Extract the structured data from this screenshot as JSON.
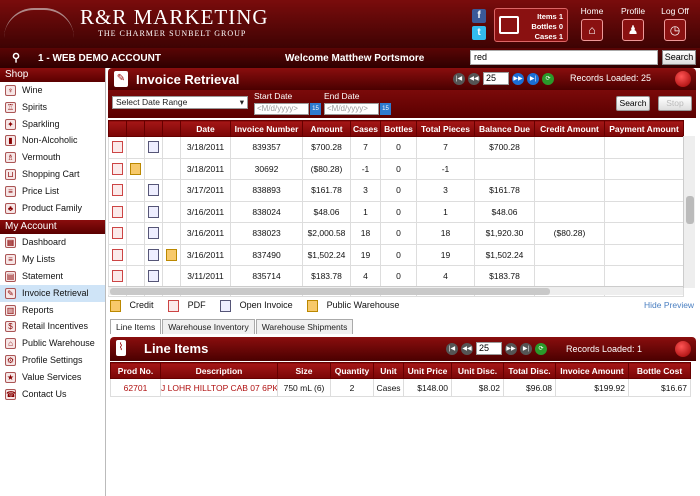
{
  "header": {
    "logo_main": "R&R MARKETING",
    "logo_sub": "THE CHARMER SUNBELT GROUP",
    "cart": {
      "items_label": "Items 1",
      "bottles_label": "Bottles 0",
      "cases_label": "Cases 1"
    },
    "nav": [
      {
        "label": "Home"
      },
      {
        "label": "Profile"
      },
      {
        "label": "Log Off"
      }
    ]
  },
  "subbar": {
    "account": "1 - WEB DEMO ACCOUNT",
    "welcome": "Welcome Matthew Portsmore",
    "search_value": "red",
    "search_button": "Search"
  },
  "sidebar": {
    "shop_title": "Shop",
    "shop_items": [
      "Wine",
      "Spirits",
      "Sparkling",
      "Non-Alcoholic",
      "Vermouth",
      "Shopping Cart",
      "Price List",
      "Product Family"
    ],
    "account_title": "My Account",
    "account_items": [
      "Dashboard",
      "My Lists",
      "Statement",
      "Invoice Retrieval",
      "Reports",
      "Retail Incentives",
      "Public Warehouse",
      "Profile Settings",
      "Value Services",
      "Contact Us"
    ],
    "selected": "Invoice Retrieval"
  },
  "invoice": {
    "title": "Invoice Retrieval",
    "page_size": "25",
    "records_loaded": "Records Loaded:  25",
    "date_range": "Select Date Range",
    "start_label": "Start Date",
    "end_label": "End Date",
    "start_placeholder": "<M/d/yyyy>",
    "end_placeholder": "<M/d/yyyy>",
    "search_btn": "Search",
    "stop_btn": "Stop",
    "columns": [
      "",
      "",
      "",
      "",
      "Date",
      "Invoice Number",
      "Amount",
      "Cases",
      "Bottles",
      "Total Pieces",
      "Balance Due",
      "Credit Amount",
      "Payment Amount"
    ],
    "rows": [
      {
        "date": "3/18/2011",
        "inv": "839357",
        "amount": "$700.28",
        "cases": "7",
        "bottles": "0",
        "pieces": "7",
        "balance": "$700.28",
        "credit": "",
        "payment": "",
        "icons": [
          "pdf",
          "",
          "doc",
          ""
        ]
      },
      {
        "date": "3/18/2011",
        "inv": "30692",
        "amount": "($80.28)",
        "cases": "-1",
        "bottles": "0",
        "pieces": "-1",
        "balance": "",
        "credit": "",
        "payment": "",
        "icons": [
          "pdf",
          "credit",
          "",
          ""
        ]
      },
      {
        "date": "3/17/2011",
        "inv": "838893",
        "amount": "$161.78",
        "cases": "3",
        "bottles": "0",
        "pieces": "3",
        "balance": "$161.78",
        "credit": "",
        "payment": "",
        "icons": [
          "pdf",
          "",
          "doc",
          ""
        ]
      },
      {
        "date": "3/16/2011",
        "inv": "838024",
        "amount": "$48.06",
        "cases": "1",
        "bottles": "0",
        "pieces": "1",
        "balance": "$48.06",
        "credit": "",
        "payment": "",
        "icons": [
          "pdf",
          "",
          "doc",
          ""
        ]
      },
      {
        "date": "3/16/2011",
        "inv": "838023",
        "amount": "$2,000.58",
        "cases": "18",
        "bottles": "0",
        "pieces": "18",
        "balance": "$1,920.30",
        "credit": "($80.28)",
        "payment": "",
        "icons": [
          "pdf",
          "",
          "doc",
          ""
        ]
      },
      {
        "date": "3/16/2011",
        "inv": "837490",
        "amount": "$1,502.24",
        "cases": "19",
        "bottles": "0",
        "pieces": "19",
        "balance": "$1,502.24",
        "credit": "",
        "payment": "",
        "icons": [
          "pdf",
          "",
          "doc",
          "truck"
        ]
      },
      {
        "date": "3/11/2011",
        "inv": "835714",
        "amount": "$183.78",
        "cases": "4",
        "bottles": "0",
        "pieces": "4",
        "balance": "$183.78",
        "credit": "",
        "payment": "",
        "icons": [
          "pdf",
          "",
          "doc",
          ""
        ]
      }
    ]
  },
  "legend": {
    "credit": "Credit",
    "pdf": "PDF",
    "open": "Open Invoice",
    "warehouse": "Public Warehouse",
    "hide": "Hide Preview"
  },
  "tabs": [
    "Line Items",
    "Warehouse Inventory",
    "Warehouse Shipments"
  ],
  "line_items": {
    "title": "Line Items",
    "page_size": "25",
    "records_loaded": "Records Loaded:  1",
    "columns": [
      "Prod No.",
      "Description",
      "Size",
      "Quantity",
      "Unit",
      "Unit Price",
      "Unit Disc.",
      "Total Disc.",
      "Invoice Amount",
      "Bottle Cost"
    ],
    "rows": [
      {
        "prod": "62701",
        "desc": "J LOHR HILLTOP CAB 07 6PK",
        "size": "750 mL (6)",
        "qty": "2",
        "unit": "Cases",
        "price": "$148.00",
        "udisc": "$8.02",
        "tdisc": "$96.08",
        "amount": "$199.92",
        "bottle": "$16.67"
      }
    ]
  },
  "colors": {
    "brand": "#7a0c0c",
    "accent_blue": "#1a6fd6",
    "link": "#4a7fc1"
  }
}
